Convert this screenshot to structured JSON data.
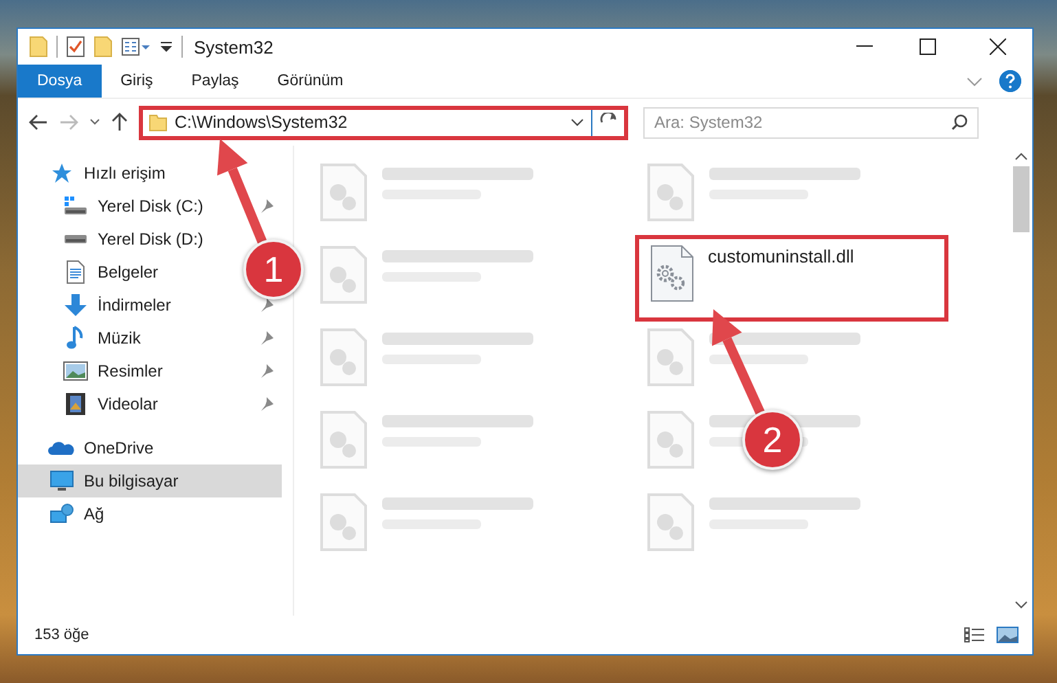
{
  "window": {
    "title": "System32"
  },
  "ribbon_tabs": [
    {
      "label": "Dosya",
      "selected": true
    },
    {
      "label": "Giriş",
      "selected": false
    },
    {
      "label": "Paylaş",
      "selected": false
    },
    {
      "label": "Görünüm",
      "selected": false
    }
  ],
  "address": {
    "path": "C:\\Windows\\System32",
    "highlighted": true
  },
  "search": {
    "placeholder": "Ara: System32"
  },
  "nav_items": [
    {
      "label": "Hızlı erişim",
      "kind": "star",
      "pinned": false,
      "selected": false,
      "children": [
        {
          "label": "Yerel Disk (C:)",
          "kind": "system-drive",
          "pinned": true,
          "selected": false
        },
        {
          "label": "Yerel Disk (D:)",
          "kind": "drive",
          "pinned": false,
          "selected": false
        },
        {
          "label": "Belgeler",
          "kind": "documents",
          "pinned": false,
          "selected": false
        },
        {
          "label": "İndirmeler",
          "kind": "downloads",
          "pinned": true,
          "selected": false
        },
        {
          "label": "Müzik",
          "kind": "music",
          "pinned": true,
          "selected": false
        },
        {
          "label": "Resimler",
          "kind": "pictures",
          "pinned": true,
          "selected": false
        },
        {
          "label": "Videolar",
          "kind": "videos",
          "pinned": true,
          "selected": false
        }
      ]
    },
    {
      "label": "OneDrive",
      "kind": "cloud",
      "pinned": false,
      "selected": false
    },
    {
      "label": "Bu bilgisayar",
      "kind": "computer",
      "pinned": false,
      "selected": true
    },
    {
      "label": "Ağ",
      "kind": "network",
      "pinned": false,
      "selected": false
    }
  ],
  "files": [
    {
      "blurred": true,
      "highlighted": false
    },
    {
      "blurred": true,
      "highlighted": false
    },
    {
      "blurred": true,
      "highlighted": false
    },
    {
      "name": "customuninstall.dll",
      "blurred": false,
      "highlighted": true
    },
    {
      "blurred": true,
      "highlighted": false
    },
    {
      "blurred": true,
      "highlighted": false
    },
    {
      "blurred": true,
      "highlighted": false
    },
    {
      "blurred": true,
      "highlighted": false
    },
    {
      "blurred": true,
      "highlighted": false
    },
    {
      "blurred": true,
      "highlighted": false
    }
  ],
  "status_bar": {
    "item_count": "153 öğe"
  },
  "step_markers": [
    {
      "label": "1"
    },
    {
      "label": "2"
    }
  ]
}
